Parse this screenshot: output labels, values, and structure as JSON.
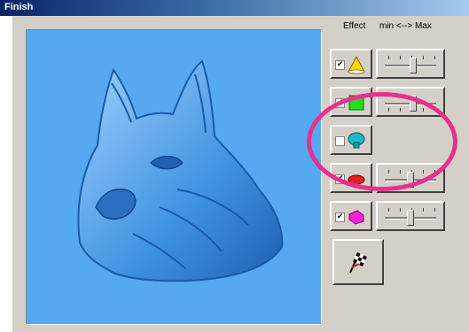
{
  "window": {
    "title": "Finish"
  },
  "header": {
    "effect_label": "Effect",
    "range_label": "min <--> Max"
  },
  "effects": [
    {
      "name": "cone-effect",
      "checked": true,
      "icon": "yellow-cone-icon",
      "has_slider": true,
      "level": 0.55
    },
    {
      "name": "green-square-effect",
      "checked": true,
      "icon": "green-square-icon",
      "has_slider": true,
      "level": 0.55
    },
    {
      "name": "mushroom-effect",
      "checked": false,
      "icon": "teal-mushroom-icon",
      "has_slider": false
    },
    {
      "name": "red-dome-effect",
      "checked": true,
      "icon": "red-dome-icon",
      "has_slider": true,
      "level": 0.5
    },
    {
      "name": "magenta-shape-effect",
      "checked": true,
      "icon": "magenta-shape-icon",
      "has_slider": true,
      "level": 0.5
    }
  ],
  "finish_button": {
    "icon": "checkered-flag-icon"
  },
  "colors": {
    "titlebar_start": "#0a246a",
    "titlebar_end": "#a6caf0",
    "preview_bg": "#56a8f0",
    "highlight_ring": "#e8308c"
  }
}
